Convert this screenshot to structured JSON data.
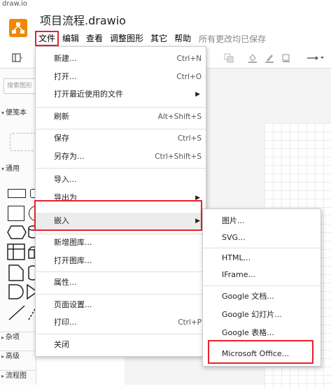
{
  "window_title": "draw.io",
  "document_title": "项目流程.drawio",
  "menubar": {
    "items": [
      "文件",
      "编辑",
      "查看",
      "调整图形",
      "其它",
      "帮助"
    ],
    "saved_status": "所有更改均已保存"
  },
  "sidebar": {
    "search_placeholder": "搜索图形",
    "sections": {
      "scratchpad": "便笺本",
      "general": "通用",
      "misc": "杂项",
      "advanced": "高级",
      "flowchart": "流程图"
    }
  },
  "file_menu": {
    "items": [
      {
        "label": "新建...",
        "shortcut": "Ctrl+N"
      },
      {
        "label": "打开...",
        "shortcut": "Ctrl+O"
      },
      {
        "label": "打开最近使用的文件",
        "shortcut": ""
      },
      {
        "label": "刷新",
        "shortcut": "Alt+Shift+S"
      },
      {
        "label": "保存",
        "shortcut": "Ctrl+S"
      },
      {
        "label": "另存为...",
        "shortcut": "Ctrl+Shift+S"
      },
      {
        "label": "导入...",
        "shortcut": ""
      },
      {
        "label": "导出为",
        "shortcut": ""
      },
      {
        "label": "嵌入",
        "shortcut": ""
      },
      {
        "label": "新增图库...",
        "shortcut": ""
      },
      {
        "label": "打开图库...",
        "shortcut": ""
      },
      {
        "label": "属性...",
        "shortcut": ""
      },
      {
        "label": "页面设置...",
        "shortcut": ""
      },
      {
        "label": "打印...",
        "shortcut": "Ctrl+P"
      },
      {
        "label": "关闭",
        "shortcut": ""
      }
    ]
  },
  "embed_submenu": {
    "items": [
      "图片...",
      "SVG...",
      "HTML...",
      "IFrame...",
      "Google 文档...",
      "Google 幻灯片...",
      "Google 表格...",
      "Microsoft Office..."
    ]
  },
  "colors": {
    "highlight": "#e8222c",
    "brand": "#f08705"
  }
}
